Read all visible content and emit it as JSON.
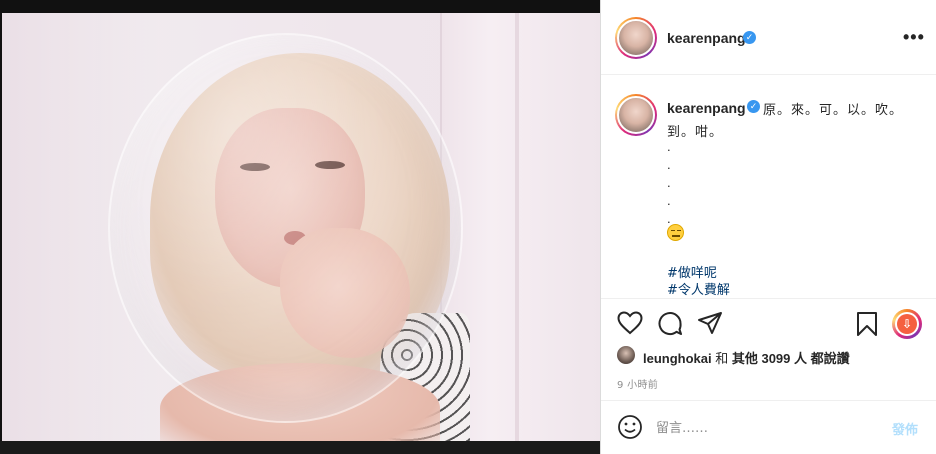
{
  "post": {
    "username": "kearenpang",
    "more_label": "•••"
  },
  "caption": {
    "username": "kearenpang",
    "line1": "原。來。可。以。吹。",
    "line2": "到。咁。",
    "dots": ".\n.\n.\n.\n.",
    "hashtags": [
      "#做咩呢",
      "#令人費解"
    ]
  },
  "likes": {
    "liker": "leunghokai",
    "middle": " 和 ",
    "others": "其他 3099 人 都說讚"
  },
  "timestamp": "9 小時前",
  "comment_box": {
    "placeholder": "留言……",
    "post_label": "發佈"
  },
  "colors": {
    "verified": "#3897f0",
    "hashtag": "#00376b",
    "post_button_disabled": "#b2dffc"
  },
  "icons": [
    "heart-icon",
    "comment-icon",
    "share-icon",
    "save-icon",
    "download-badge-icon",
    "smiley-icon",
    "verified-icon"
  ]
}
